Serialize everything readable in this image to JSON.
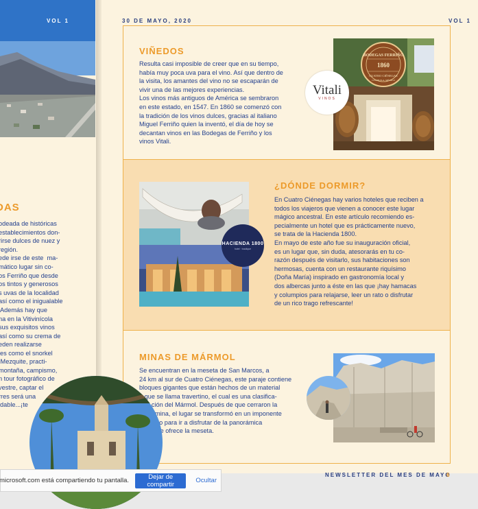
{
  "left_page": {
    "vol": "VOL 1",
    "section_title": "DAS",
    "text1": "odeada de históricas\nestablecimientos don-\nrirse dulces de nuez y\nregión.\nede irse de este  ma-\nmático lugar sin co-\nos Ferriño que desde\nos tintos y generosos\ns uvas de la localidad\nasí como el inigualable\n Además hay que\nna en la Vitivinícola\nsus exquisitos vinos\nasí como su crema de",
    "text2": "eden realizarse\nles como el snorkel\n Mezquite, practi-\nmontaña, campismo,\nn tour fotográfico de\nvestre, captar el\nrres será una\nidable...¡te"
  },
  "header": {
    "date": "30 DE MAYO, 2020",
    "vol": "VOL 1"
  },
  "vinedos": {
    "title": "VIÑEDOS",
    "text": "Resulta casi imposible de creer que en su tiempo,\nhabía muy poca uva para el vino. Así que dentro de\nla visita, los amantes del vino no se escaparán de\nvivir una de las mejores experiencias.\nLos vinos más antiguos de América se sembraron\nen este estado, en 1547. En 1860 se comenzó con\nla tradición de los vinos dulces, gracias al italiano\nMiguel Ferriño quien la inventó, el día de hoy se\ndecantan vinos en las Bodegas de Ferriño y los\nvinos Vitali.",
    "sign_name": "BODEGAS FERRIÑO",
    "sign_year": "1860",
    "sign_place": "CUATRO CIÉNEGAS",
    "sign_region": "COAHUILA, MÉXICO",
    "badge_logo": "Vitali",
    "badge_sub": "VINOS"
  },
  "dormir": {
    "title": "¿DÓNDE DORMIR?",
    "text": "En Cuatro Ciénegas hay varios hoteles que reciben a\ntodos los viajeros que vienen a conocer este lugar\nmágico ancestral. En este artículo recomiendo es-\npecialmente un hotel que es prácticamente nuevo,\nse trata de la Hacienda 1800.\nEn mayo de este año fue su inauguración oficial,\nes un lugar que, sin duda, atesorarás en tu co-\nrazón después de visitarlo, sus habitaciones son\nhermosas, cuenta con un restaurante riquísimo\n(Doña María) inspirado en gastronomía local y\ndos albercas junto a éste en las que ¡hay hamacas\ny columpios para relajarse, leer un rato o disfrutar\nde un rico trago refrescante!",
    "badge_name": "HACIENDA 1800",
    "badge_sub": "hotel · boutique"
  },
  "minas": {
    "title": "MINAS DE MÁRMOL",
    "text": "Se encuentran en la meseta de San Marcos, a\n24 km al sur de Cuatro Ciénegas, este paraje contiene\nbloques gigantes que están hechos de un material\n   que se llama travertino, el cual es una clasifica-\n       ción del Mármol. Después de que cerraron la\n         mina, el lugar se transformó en un imponente\n       sitio para ir a disfrutar de la panorámica\n        que ofrece la meseta."
  },
  "footer": {
    "newsletter": "NEWSLETTER DEL MES DE MAYO",
    "page": "6"
  },
  "share_bar": {
    "message": "microsoft.com está compartiendo tu pantalla.",
    "stop_label": "Dejar de compartir",
    "hide_label": "Ocultar"
  },
  "colors": {
    "accent": "#ec9a2a",
    "text": "#23408e",
    "page": "#fcf3df",
    "band": "#f9ddb1",
    "button": "#2c6bd2"
  }
}
